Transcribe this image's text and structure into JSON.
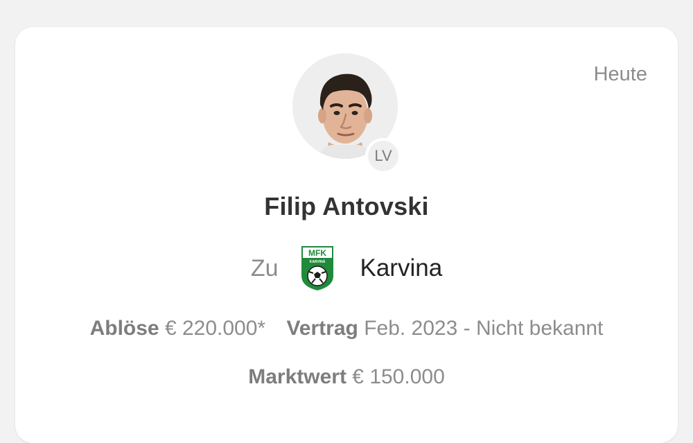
{
  "transfer": {
    "date": "Heute",
    "player": {
      "name": "Filip Antovski",
      "position": "LV",
      "photo_icon": "player-photo"
    },
    "destination": {
      "prefix": "Zu",
      "club_name": "Karvina",
      "logo_text_top": "MFK",
      "logo_text_bottom": "KARVINÁ",
      "logo_colors": {
        "green": "#1f8a3a",
        "white": "#ffffff",
        "black": "#1a1a1a"
      }
    },
    "fee": {
      "label": "Ablöse",
      "value": "€ 220.000*"
    },
    "contract": {
      "label": "Vertrag",
      "value": "Feb. 2023 - Nicht bekannt"
    },
    "market_value": {
      "label": "Marktwert",
      "value": "€ 150.000"
    }
  }
}
